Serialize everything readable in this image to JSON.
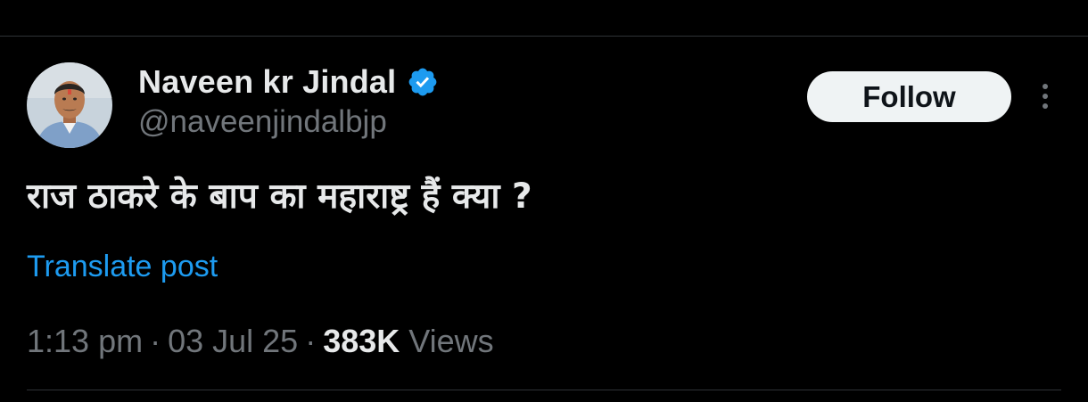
{
  "author": {
    "display_name": "Naveen kr Jindal",
    "handle": "@naveenjindalbjp",
    "verified": true,
    "verified_color": "#1d9bf0",
    "avatar_icon": "profile-photo"
  },
  "actions": {
    "follow_label": "Follow",
    "more_icon": "more-vertical-icon"
  },
  "tweet": {
    "text": "राज ठाकरे के बाप का महाराष्ट्र हैं क्या ?",
    "translate_label": "Translate post"
  },
  "meta": {
    "time": "1:13 pm",
    "separator": "·",
    "date": "03 Jul 25",
    "views_count": "383K",
    "views_label": "Views"
  },
  "colors": {
    "background": "#000000",
    "text_primary": "#e7e9ea",
    "text_secondary": "#71767b",
    "link": "#1d9bf0",
    "divider": "#2f3336",
    "button_bg": "#eff3f4"
  }
}
